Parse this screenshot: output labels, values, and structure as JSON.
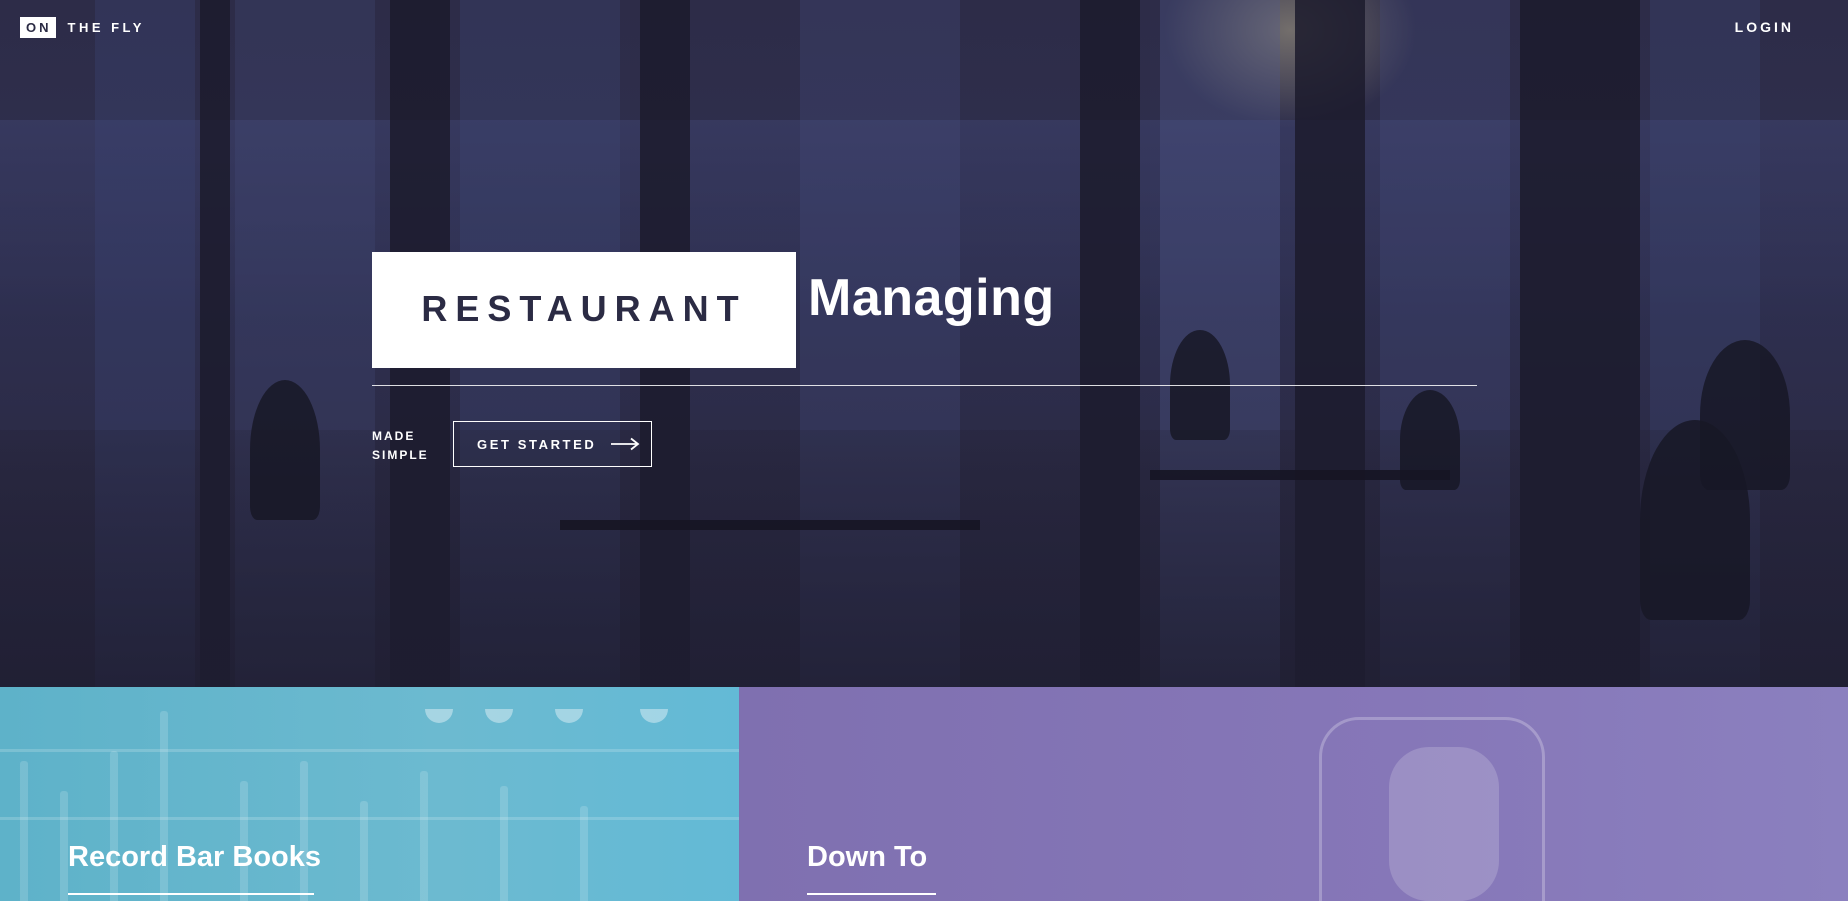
{
  "header": {
    "logo_badge": "ON",
    "logo_text": "THE FLY",
    "login_label": "LOGIN"
  },
  "hero": {
    "title_boxed": "RESTAURANT",
    "title_word": "Managing",
    "tagline_line1": "MADE",
    "tagline_line2": "SIMPLE",
    "cta_label": "GET STARTED",
    "cta_icon": "arrow-right-icon"
  },
  "cards": [
    {
      "title": "Record Bar Books",
      "color": "#63b6cf"
    },
    {
      "title": "Down To",
      "color": "#8274b4"
    }
  ],
  "colors": {
    "hero_overlay": "#2b2b44",
    "text_on_dark": "#ffffff"
  }
}
